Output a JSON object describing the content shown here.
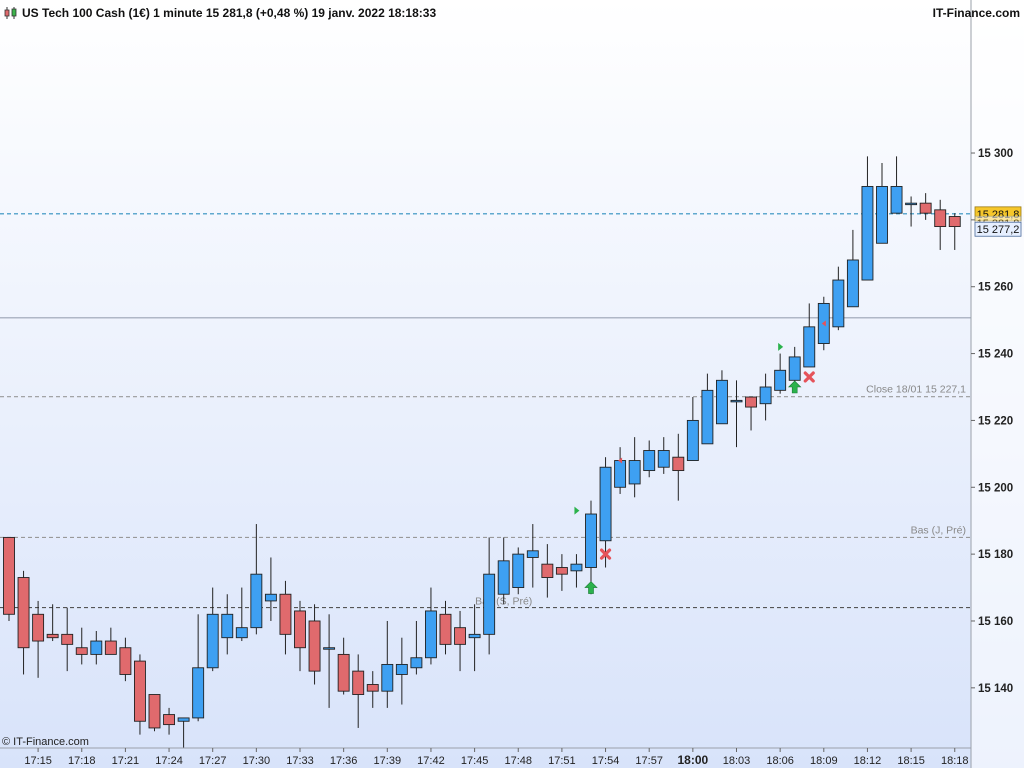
{
  "header": {
    "title": "US Tech 100 Cash (1€) 1 minute 15 281,8 (+0,48 %) 19 janv. 2022 18:18:33",
    "brand": "IT-Finance.com"
  },
  "footer": {
    "copyright": "© IT-Finance.com"
  },
  "colors": {
    "up": "#3ea0f2",
    "down": "#e06a6d",
    "current_price_line": "#2f8fc0",
    "price_box_bg": "#f6c72b",
    "bg_top": "#ffffff",
    "bg_bottom": "#d8e3fa",
    "buy_arrow": "#2bb24c",
    "sell_cross": "#e5535a"
  },
  "chart_data": {
    "type": "candlestick",
    "instrument": "US Tech 100 Cash (1€)",
    "timeframe": "1 minute",
    "ylim": [
      15122,
      15338
    ],
    "y_ticks": [
      15140,
      15160,
      15180,
      15200,
      15220,
      15240,
      15260,
      15280,
      15300
    ],
    "y_tick_labels": [
      "15 140",
      "15 160",
      "15 180",
      "15 200",
      "15 220",
      "15 240",
      "15 260",
      "15 281,8",
      "15 300"
    ],
    "x_labels": [
      {
        "label": "17:15",
        "index": 2
      },
      {
        "label": "17:18",
        "index": 5
      },
      {
        "label": "17:21",
        "index": 8
      },
      {
        "label": "17:24",
        "index": 11
      },
      {
        "label": "17:27",
        "index": 14
      },
      {
        "label": "17:30",
        "index": 17
      },
      {
        "label": "17:33",
        "index": 20
      },
      {
        "label": "17:36",
        "index": 23
      },
      {
        "label": "17:39",
        "index": 26
      },
      {
        "label": "17:42",
        "index": 29
      },
      {
        "label": "17:45",
        "index": 32
      },
      {
        "label": "17:48",
        "index": 35
      },
      {
        "label": "17:51",
        "index": 38
      },
      {
        "label": "17:54",
        "index": 41
      },
      {
        "label": "17:57",
        "index": 44
      },
      {
        "label": "18:00",
        "index": 47,
        "bold": true
      },
      {
        "label": "18:03",
        "index": 50
      },
      {
        "label": "18:06",
        "index": 53
      },
      {
        "label": "18:09",
        "index": 56
      },
      {
        "label": "18:12",
        "index": 59
      },
      {
        "label": "18:15",
        "index": 62
      },
      {
        "label": "18:18",
        "index": 65
      }
    ],
    "candles": [
      {
        "o": 15185,
        "h": 15185,
        "l": 15160,
        "c": 15162
      },
      {
        "o": 15173,
        "h": 15175,
        "l": 15144,
        "c": 15152
      },
      {
        "o": 15162,
        "h": 15166,
        "l": 15143,
        "c": 15154
      },
      {
        "o": 15156,
        "h": 15165,
        "l": 15154,
        "c": 15155
      },
      {
        "o": 15156,
        "h": 15164,
        "l": 15145,
        "c": 15153
      },
      {
        "o": 15152,
        "h": 15158,
        "l": 15147,
        "c": 15150
      },
      {
        "o": 15150,
        "h": 15157,
        "l": 15147,
        "c": 15154
      },
      {
        "o": 15154,
        "h": 15158,
        "l": 15150,
        "c": 15150
      },
      {
        "o": 15152,
        "h": 15155,
        "l": 15142,
        "c": 15144
      },
      {
        "o": 15148,
        "h": 15150,
        "l": 15126,
        "c": 15130
      },
      {
        "o": 15138,
        "h": 15138,
        "l": 15127,
        "c": 15128
      },
      {
        "o": 15132,
        "h": 15134,
        "l": 15126,
        "c": 15129
      },
      {
        "o": 15130,
        "h": 15131,
        "l": 15122,
        "c": 15131
      },
      {
        "o": 15131,
        "h": 15162,
        "l": 15130,
        "c": 15146
      },
      {
        "o": 15146,
        "h": 15170,
        "l": 15145,
        "c": 15162
      },
      {
        "o": 15155,
        "h": 15168,
        "l": 15150,
        "c": 15162
      },
      {
        "o": 15155,
        "h": 15170,
        "l": 15154,
        "c": 15158
      },
      {
        "o": 15158,
        "h": 15189,
        "l": 15156,
        "c": 15174
      },
      {
        "o": 15166,
        "h": 15179,
        "l": 15160,
        "c": 15168
      },
      {
        "o": 15168,
        "h": 15172,
        "l": 15150,
        "c": 15156
      },
      {
        "o": 15163,
        "h": 15166,
        "l": 15145,
        "c": 15152
      },
      {
        "o": 15160,
        "h": 15165,
        "l": 15141,
        "c": 15145
      },
      {
        "o": 15152,
        "h": 15162,
        "l": 15134,
        "c": 15152
      },
      {
        "o": 15150,
        "h": 15155,
        "l": 15138,
        "c": 15139
      },
      {
        "o": 15145,
        "h": 15150,
        "l": 15128,
        "c": 15138
      },
      {
        "o": 15141,
        "h": 15145,
        "l": 15134,
        "c": 15139
      },
      {
        "o": 15139,
        "h": 15160,
        "l": 15134,
        "c": 15147
      },
      {
        "o": 15144,
        "h": 15155,
        "l": 15135,
        "c": 15147
      },
      {
        "o": 15146,
        "h": 15160,
        "l": 15144,
        "c": 15149
      },
      {
        "o": 15149,
        "h": 15170,
        "l": 15147,
        "c": 15163
      },
      {
        "o": 15162,
        "h": 15166,
        "l": 15150,
        "c": 15153
      },
      {
        "o": 15158,
        "h": 15163,
        "l": 15145,
        "c": 15153
      },
      {
        "o": 15155,
        "h": 15165,
        "l": 15145,
        "c": 15156
      },
      {
        "o": 15156,
        "h": 15185,
        "l": 15150,
        "c": 15174
      },
      {
        "o": 15168,
        "h": 15185,
        "l": 15165,
        "c": 15178
      },
      {
        "o": 15170,
        "h": 15182,
        "l": 15168,
        "c": 15180
      },
      {
        "o": 15179,
        "h": 15189,
        "l": 15170,
        "c": 15181
      },
      {
        "o": 15177,
        "h": 15183,
        "l": 15167,
        "c": 15173
      },
      {
        "o": 15176,
        "h": 15180,
        "l": 15169,
        "c": 15174
      },
      {
        "o": 15175,
        "h": 15180,
        "l": 15170,
        "c": 15177
      },
      {
        "o": 15176,
        "h": 15196,
        "l": 15168,
        "c": 15192
      },
      {
        "o": 15184,
        "h": 15209,
        "l": 15176,
        "c": 15206
      },
      {
        "o": 15200,
        "h": 15212,
        "l": 15198,
        "c": 15208
      },
      {
        "o": 15201,
        "h": 15215,
        "l": 15197,
        "c": 15208
      },
      {
        "o": 15205,
        "h": 15214,
        "l": 15203,
        "c": 15211
      },
      {
        "o": 15206,
        "h": 15215,
        "l": 15204,
        "c": 15211
      },
      {
        "o": 15209,
        "h": 15216,
        "l": 15196,
        "c": 15205
      },
      {
        "o": 15208,
        "h": 15227,
        "l": 15208,
        "c": 15220
      },
      {
        "o": 15213,
        "h": 15234,
        "l": 15213,
        "c": 15229
      },
      {
        "o": 15219,
        "h": 15235,
        "l": 15219,
        "c": 15232
      },
      {
        "o": 15226,
        "h": 15232,
        "l": 15212,
        "c": 15226
      },
      {
        "o": 15227,
        "h": 15227,
        "l": 15217,
        "c": 15224
      },
      {
        "o": 15225,
        "h": 15234,
        "l": 15220,
        "c": 15230
      },
      {
        "o": 15229,
        "h": 15240,
        "l": 15228,
        "c": 15235
      },
      {
        "o": 15232,
        "h": 15242,
        "l": 15231,
        "c": 15239
      },
      {
        "o": 15236,
        "h": 15255,
        "l": 15236,
        "c": 15248
      },
      {
        "o": 15243,
        "h": 15257,
        "l": 15241,
        "c": 15255
      },
      {
        "o": 15248,
        "h": 15266,
        "l": 15247,
        "c": 15262
      },
      {
        "o": 15254,
        "h": 15277,
        "l": 15254,
        "c": 15268
      },
      {
        "o": 15262,
        "h": 15299,
        "l": 15262,
        "c": 15290
      },
      {
        "o": 15273,
        "h": 15297,
        "l": 15273,
        "c": 15290
      },
      {
        "o": 15282,
        "h": 15299,
        "l": 15282,
        "c": 15290
      },
      {
        "o": 15285,
        "h": 15287,
        "l": 15278,
        "c": 15285
      },
      {
        "o": 15285,
        "h": 15288,
        "l": 15280,
        "c": 15282
      },
      {
        "o": 15283,
        "h": 15286,
        "l": 15271,
        "c": 15278
      },
      {
        "o": 15281,
        "h": 15282,
        "l": 15271,
        "c": 15278
      }
    ],
    "horizontal_lines": [
      {
        "price": 15281.8,
        "style": "dashed",
        "color": "#2f8fc0",
        "label": ""
      },
      {
        "price": 15250.7,
        "style": "solid",
        "color": "#9aa3b3",
        "label": ""
      },
      {
        "price": 15227.1,
        "style": "dashed",
        "color": "#999999",
        "label": "Close 18/01 15 227,1",
        "label_pos": "right"
      },
      {
        "price": 15185.0,
        "style": "dashed",
        "color": "#999999",
        "label": "Bas (J, Pré)",
        "label_pos": "right"
      },
      {
        "price": 15164.0,
        "style": "dashed",
        "color": "#555555",
        "label": "Bas (S, Pré)",
        "label_pos": "mid",
        "label_index": 34
      }
    ],
    "price_boxes": [
      {
        "price": 15281.8,
        "label": "15 281,8",
        "bg": "#f6c72b",
        "border": "#9a7a10"
      },
      {
        "price": 15279.0,
        "label": "15 281,8",
        "bg": "#ffffff",
        "border": "#7a90b0",
        "faded": true
      },
      {
        "price": 15277.2,
        "label": "15 277,2",
        "bg": "#e6efff",
        "border": "#4a6a9a"
      }
    ],
    "markers": [
      {
        "type": "buy-arrow",
        "index": 40,
        "price": 15170
      },
      {
        "type": "sell-cross",
        "index": 41,
        "price": 15180
      },
      {
        "type": "buy-arrow",
        "index": 54,
        "price": 15230
      },
      {
        "type": "sell-cross",
        "index": 55,
        "price": 15233
      },
      {
        "type": "green-flag",
        "index": 39,
        "price": 15193
      },
      {
        "type": "red-flag",
        "index": 42,
        "price": 15208
      },
      {
        "type": "green-flag",
        "index": 53,
        "price": 15242
      },
      {
        "type": "red-flag",
        "index": 56,
        "price": 15249
      }
    ]
  }
}
